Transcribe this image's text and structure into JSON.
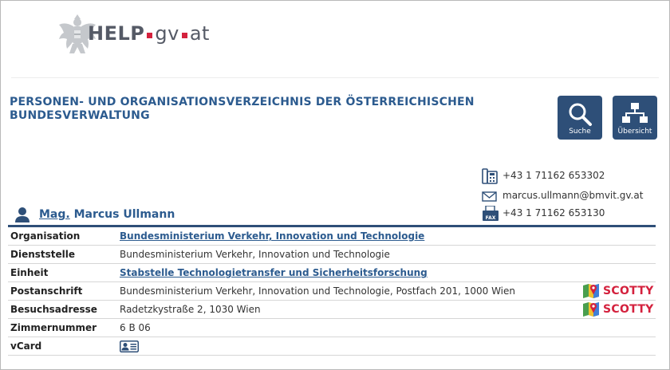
{
  "header": {
    "logo_help": "HELP",
    "logo_gv": "gv",
    "logo_at": "at"
  },
  "page": {
    "title": "PERSONEN- UND ORGANISATIONSVERZEICHNIS DER ÖSTERREICHISCHEN BUNDESVERWALTUNG"
  },
  "actions": {
    "search_label": "Suche",
    "overview_label": "Übersicht"
  },
  "contact": {
    "phone": "+43 1 71162 653302",
    "email": "marcus.ullmann@bmvit.gv.at",
    "fax": "+43 1 71162 653130",
    "fax_icon_text": "FAX"
  },
  "person": {
    "title": "Mag.",
    "name": "Marcus Ullmann"
  },
  "details": {
    "organisation_label": "Organisation",
    "organisation_value": "Bundesministerium Verkehr, Innovation und Technologie",
    "dienststelle_label": "Dienststelle",
    "dienststelle_value": "Bundesministerium Verkehr, Innovation und Technologie",
    "einheit_label": "Einheit",
    "einheit_value": "Stabstelle Technologietransfer und Sicherheitsforschung",
    "postanschrift_label": "Postanschrift",
    "postanschrift_value": "Bundesministerium Verkehr, Innovation und Technologie, Postfach 201, 1000 Wien",
    "besuchsadresse_label": "Besuchsadresse",
    "besuchsadresse_value": "Radetzkystraße 2, 1030 Wien",
    "zimmernummer_label": "Zimmernummer",
    "zimmernummer_value": "6 B 06",
    "vcard_label": "vCard",
    "scotty_label": "SCOTTY"
  },
  "colors": {
    "primary": "#2e4f78",
    "link": "#2c5b8f",
    "accent_red": "#d4213d"
  }
}
